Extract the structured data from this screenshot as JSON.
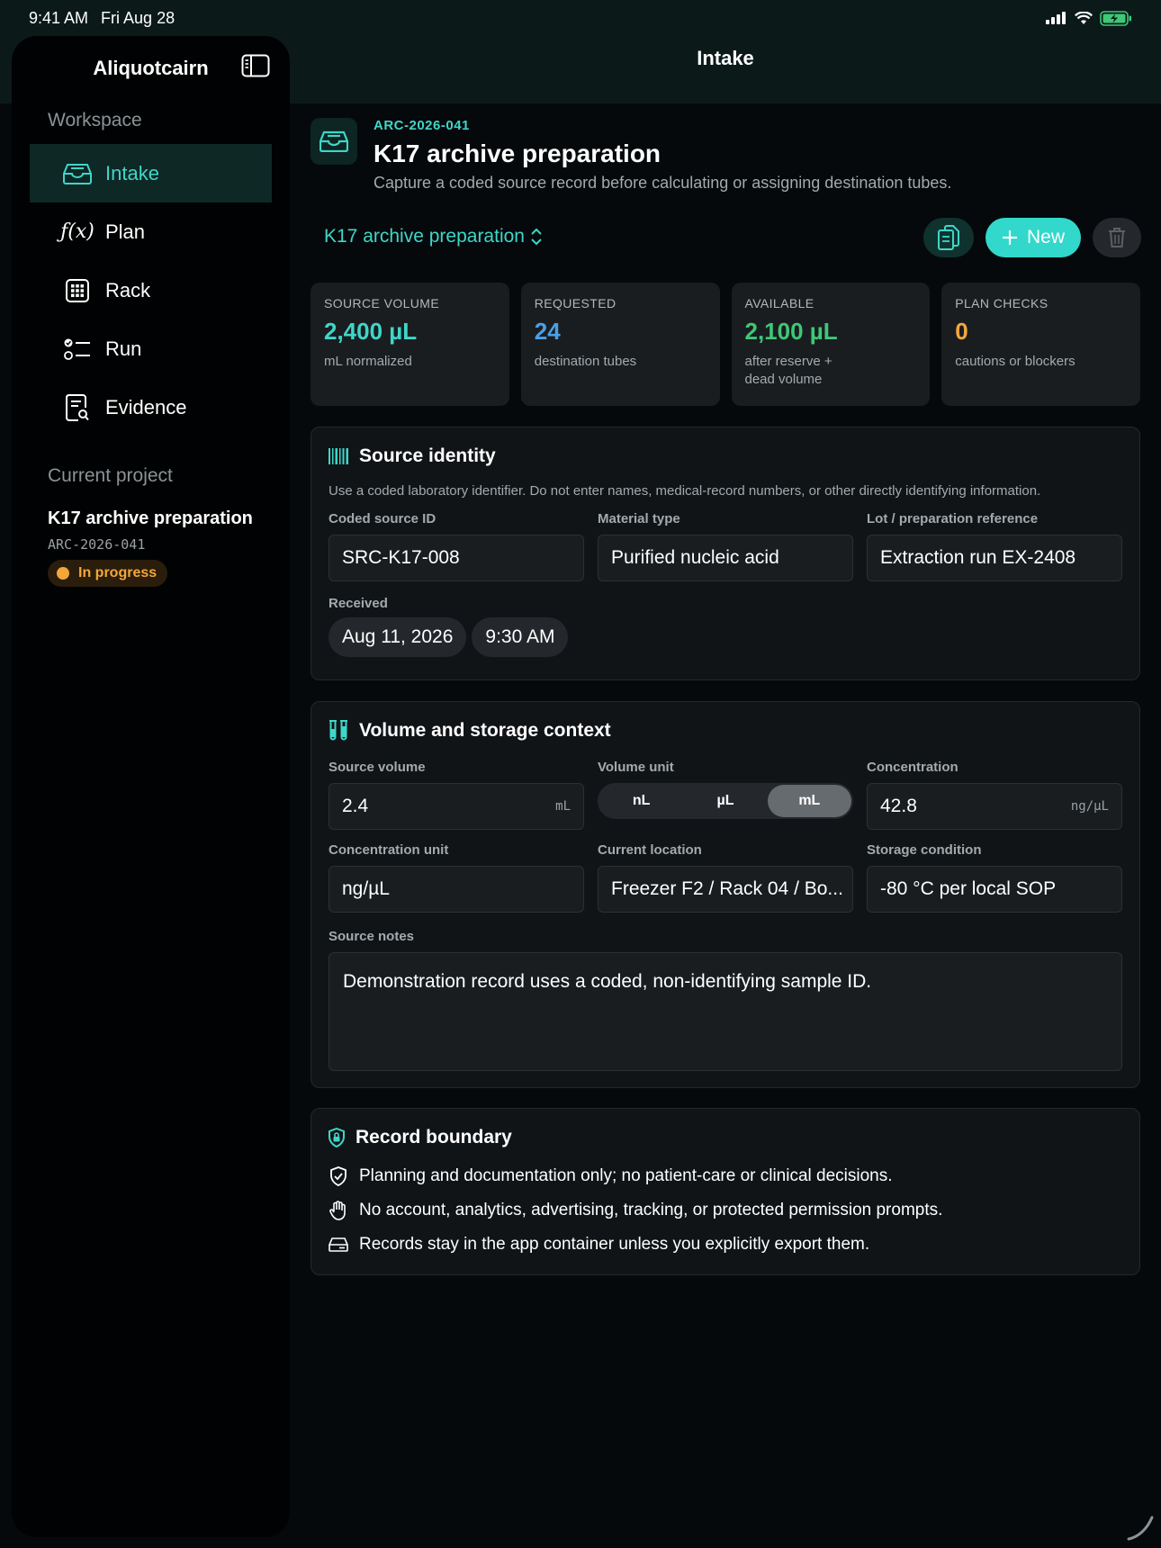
{
  "status_bar": {
    "time": "9:41 AM",
    "date": "Fri Aug 28"
  },
  "sidebar": {
    "app_name": "Aliquotcairn",
    "section_workspace": "Workspace",
    "items": [
      {
        "label": "Intake",
        "icon": "tray-icon",
        "active": true
      },
      {
        "label": "Plan",
        "icon": "function-icon",
        "active": false
      },
      {
        "label": "Rack",
        "icon": "grid-icon",
        "active": false
      },
      {
        "label": "Run",
        "icon": "checklist-icon",
        "active": false
      },
      {
        "label": "Evidence",
        "icon": "doc-search-icon",
        "active": false
      }
    ],
    "section_project": "Current project",
    "project": {
      "title": "K17 archive preparation",
      "code": "ARC-2026-041",
      "status": "In progress"
    }
  },
  "nav_title": "Intake",
  "header": {
    "code": "ARC-2026-041",
    "title": "K17 archive preparation",
    "subtitle": "Capture a coded source record before calculating or assigning destination tubes."
  },
  "toolbar": {
    "project_picker": "K17 archive preparation",
    "new_label": "New"
  },
  "stats": [
    {
      "label": "SOURCE VOLUME",
      "value": "2,400 µL",
      "sub": "mL normalized",
      "color": "#3fd6c8"
    },
    {
      "label": "REQUESTED",
      "value": "24",
      "sub": "destination tubes",
      "color": "#4a9fe8"
    },
    {
      "label": "AVAILABLE",
      "value": "2,100 µL",
      "sub": "after reserve + dead volume",
      "color": "#3ec877"
    },
    {
      "label": "PLAN CHECKS",
      "value": "0",
      "sub": "cautions or blockers",
      "color": "#f3a73a"
    }
  ],
  "source_identity": {
    "title": "Source identity",
    "note": "Use a coded laboratory identifier. Do not enter names, medical-record numbers, or other directly identifying information.",
    "coded_id_label": "Coded source ID",
    "coded_id_value": "SRC-K17-008",
    "material_label": "Material type",
    "material_value": "Purified nucleic acid",
    "lot_label": "Lot / preparation reference",
    "lot_value": "Extraction run EX-2408",
    "received_label": "Received",
    "received_date": "Aug 11, 2026",
    "received_time": "9:30 AM"
  },
  "volume": {
    "title": "Volume and storage context",
    "source_volume_label": "Source volume",
    "source_volume_value": "2.4",
    "source_volume_unit": "mL",
    "unit_label": "Volume unit",
    "unit_options": [
      "nL",
      "µL",
      "mL"
    ],
    "unit_selected": "mL",
    "concentration_label": "Concentration",
    "concentration_value": "42.8",
    "concentration_unit": "ng/µL",
    "conc_unit_label": "Concentration unit",
    "conc_unit_value": "ng/µL",
    "location_label": "Current location",
    "location_value": "Freezer F2 / Rack 04 / Bo...",
    "storage_label": "Storage condition",
    "storage_value": "-80 °C per local SOP",
    "notes_label": "Source notes",
    "notes_value": "Demonstration record uses a coded, non-identifying sample ID."
  },
  "boundary": {
    "title": "Record boundary",
    "items": [
      "Planning and documentation only; no patient-care or clinical decisions.",
      "No account, analytics, advertising, tracking, or protected permission prompts.",
      "Records stay in the app container unless you explicitly export them."
    ]
  }
}
